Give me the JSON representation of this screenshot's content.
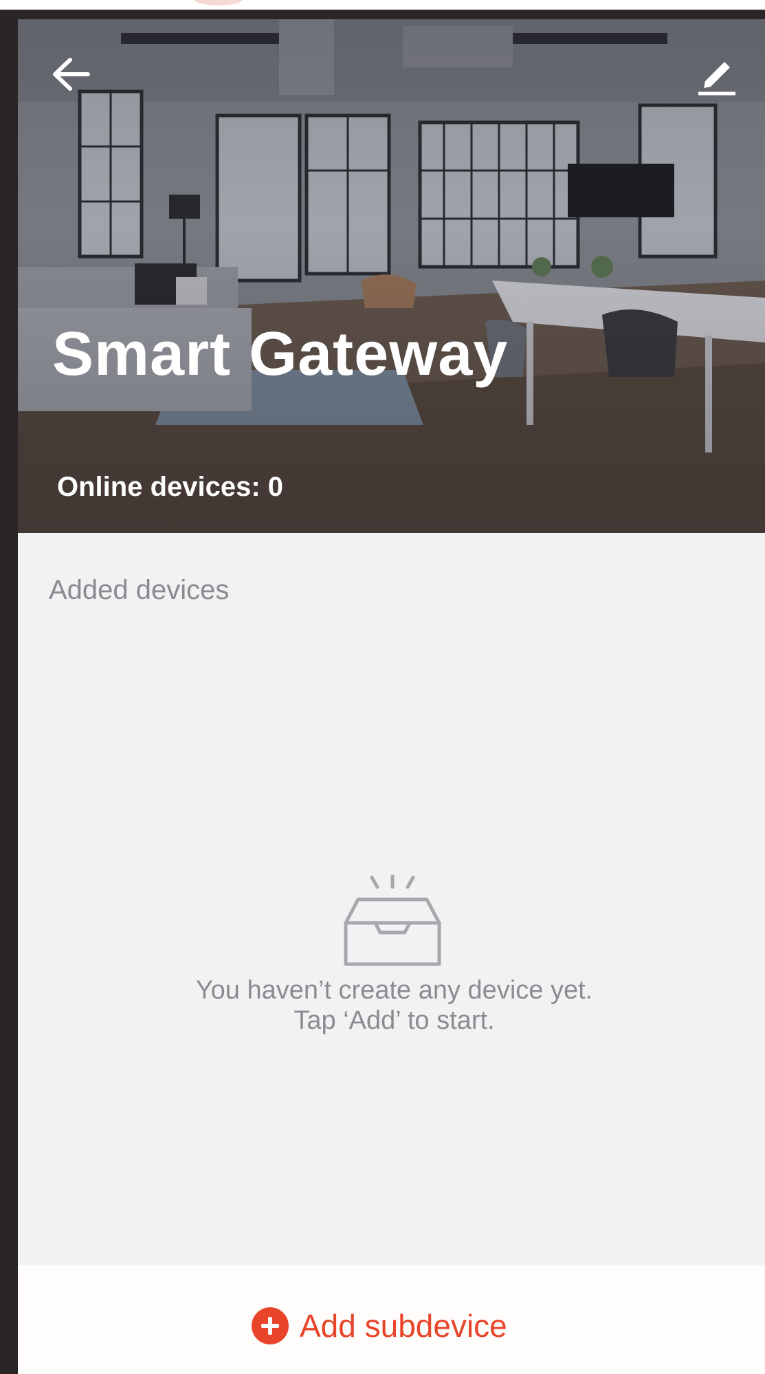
{
  "header": {
    "back_icon": "arrow-left-icon",
    "edit_icon": "pencil-icon",
    "title": "Smart Gateway",
    "online_devices": "Online devices: 0"
  },
  "content": {
    "section_title": "Added devices",
    "empty_state": {
      "icon": "empty-inbox-icon",
      "line1": "You haven’t create any device yet.",
      "line2": "Tap ‘Add’ to start."
    }
  },
  "footer": {
    "add_icon": "plus-circle-icon",
    "add_label": "Add subdevice"
  },
  "colors": {
    "accent": "#e8442a",
    "muted_text": "#8b8b93",
    "background": "#f2f2f2"
  }
}
